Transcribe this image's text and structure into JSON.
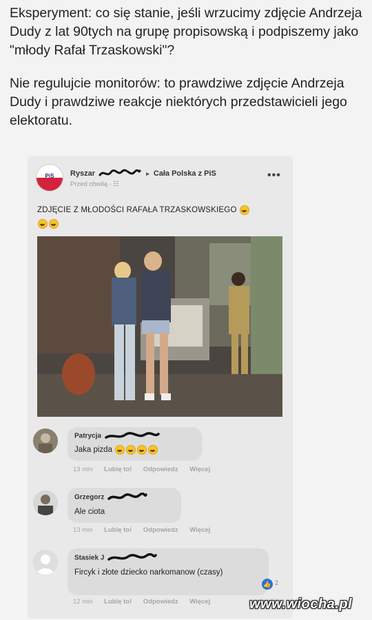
{
  "caption": {
    "line1": "Eksperyment: co się stanie, jeśli wrzucimy zdjęcie Andrzeja Dudy z lat 90tych na grupę propisowską i podpiszemy jako \"młody Rafał Trzaskowski\"?",
    "line2": "Nie regulujcie monitorów: to prawdziwe zdjęcie Andrzeja Dudy i prawdziwe reakcje niektórych przedstawicieli jego elektoratu."
  },
  "post": {
    "author": "Ryszar",
    "arrow": "▸",
    "group": "Cała Polska z PiS",
    "time": "Przed chwilą · ☷",
    "more": "•••",
    "text": "ZDJĘCIE Z MŁODOŚCI RAFAŁA TRZASKOWSKIEGO",
    "icons": {
      "avatar": "pis-logo-icon",
      "photo": "photo"
    }
  },
  "comments": [
    {
      "name": "Patrycja",
      "text": "Jaka pizda",
      "time": "13 min",
      "like": "Lubię to!",
      "reply": "Odpowiedz",
      "more": "Więcej"
    },
    {
      "name": "Grzegorz",
      "text": "Ale ciota",
      "time": "13 min",
      "like": "Lubię to!",
      "reply": "Odpowiedz",
      "more": "Więcej"
    },
    {
      "name": "Stasiek J",
      "text": "Fircyk i złote dziecko narkomanow (czasy)",
      "time": "12 min",
      "like": "Lubię to!",
      "reply": "Odpowiedz",
      "more": "Więcej",
      "likes": "2"
    }
  ],
  "watermark": "www.wiocha.pl",
  "colors": {
    "background": "#f3f3f3",
    "card": "#e9e9e9",
    "bubble": "#dcdcdc",
    "like_blue": "#2d6fd6"
  }
}
